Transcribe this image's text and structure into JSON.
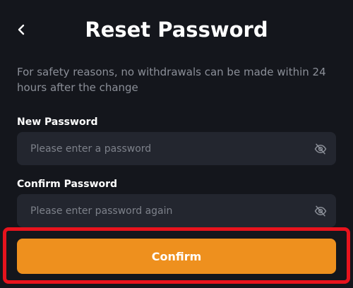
{
  "header": {
    "back_icon": "chevron-left-icon",
    "title": "Reset Password"
  },
  "notice": "For safety reasons, no withdrawals can be made within 24 hours after the change",
  "new_password": {
    "label": "New Password",
    "value": "",
    "placeholder": "Please enter a password",
    "toggle_icon": "eye-off-icon"
  },
  "confirm_password": {
    "label": "Confirm Password",
    "value": "",
    "placeholder": "Please enter password again",
    "toggle_icon": "eye-off-icon"
  },
  "confirm_button": {
    "label": "Confirm"
  },
  "colors": {
    "background": "#14161c",
    "field_background": "#23262f",
    "accent": "#ee901e",
    "highlight": "#e8131d",
    "muted_text": "#8b8f98"
  }
}
